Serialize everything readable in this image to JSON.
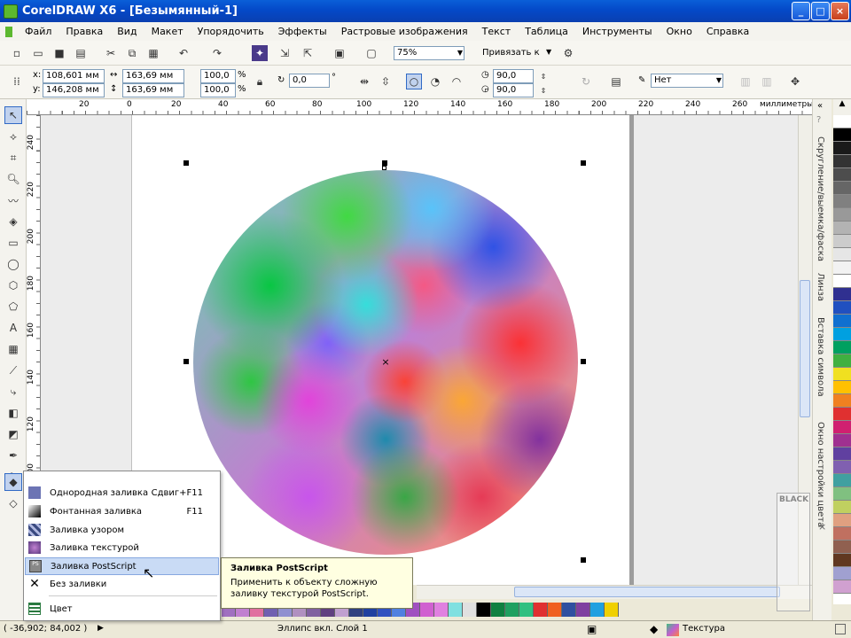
{
  "window": {
    "title": "CorelDRAW X6 - [Безымянный-1]",
    "controls": [
      "_",
      "□",
      "×"
    ]
  },
  "menu": [
    "Файл",
    "Правка",
    "Вид",
    "Макет",
    "Упорядочить",
    "Эффекты",
    "Растровые изображения",
    "Текст",
    "Таблица",
    "Инструменты",
    "Окно",
    "Справка"
  ],
  "toolbar": {
    "zoom": "75%",
    "snap_label": "Привязать к"
  },
  "propbar": {
    "x": "108,601 мм",
    "y": "146,208 мм",
    "w": "163,69 мм",
    "h": "163,69 мм",
    "sx": "100,0",
    "sy": "100,0",
    "pct": "%",
    "rotation": "0,0",
    "deg": "°",
    "angle1": "90,0",
    "angle2": "90,0",
    "outline": "Нет"
  },
  "ruler": {
    "top_ticks": [
      "20",
      "0",
      "20",
      "40",
      "60",
      "80",
      "100",
      "120",
      "140",
      "160",
      "180",
      "200",
      "220",
      "240",
      "260"
    ],
    "units": "миллиметры",
    "left_ticks": [
      "240",
      "220",
      "200",
      "180",
      "160",
      "140",
      "120",
      "100"
    ]
  },
  "dockers": [
    "Скругление/выемка/фаска",
    "Линза",
    "Вставка символа",
    "Окно настройки цвета"
  ],
  "fill_menu": {
    "items": [
      {
        "label": "Однородная заливка",
        "shortcut": "Сдвиг+F11",
        "icon": "uniform-fill-icon",
        "color": "#6c74b4"
      },
      {
        "label": "Фонтанная заливка",
        "shortcut": "F11",
        "icon": "fountain-fill-icon",
        "color": "#333333"
      },
      {
        "label": "Заливка узором",
        "shortcut": "",
        "icon": "pattern-fill-icon",
        "color": "#5a6aa0"
      },
      {
        "label": "Заливка текстурой",
        "shortcut": "",
        "icon": "texture-fill-icon",
        "color": "#7a5aa0"
      },
      {
        "label": "Заливка PostScript",
        "shortcut": "",
        "icon": "postscript-fill-icon",
        "color": "#888888"
      },
      {
        "label": "Без заливки",
        "shortcut": "",
        "icon": "no-fill-icon",
        "color": "#333333"
      },
      {
        "label": "Цвет",
        "shortcut": "",
        "icon": "color-icon",
        "color": "#2a7a40"
      }
    ]
  },
  "tooltip": {
    "title": "Заливка PostScript",
    "body": "Применить к объекту сложную заливку текстурой PostScript."
  },
  "status": {
    "coords": "( -36,902; 84,002 )",
    "object": "Эллипс вкл. Слой 1",
    "fill": "Текстура"
  },
  "watermark": {
    "text": "BLACK"
  },
  "palette_colors": [
    "#ffffff",
    "#000000",
    "#1a1a1a",
    "#333333",
    "#4d4d4d",
    "#666666",
    "#808080",
    "#999999",
    "#b3b3b3",
    "#cccccc",
    "#e6e6e6",
    "#f2f2f2",
    "#ffffff",
    "#303090",
    "#2050c0",
    "#1070d0",
    "#00a0e0",
    "#00a060",
    "#40b040",
    "#f0e020",
    "#ffc000",
    "#f08020",
    "#e03030",
    "#d02070",
    "#a03090",
    "#6040a0",
    "#8060b0",
    "#40a0a0",
    "#80c080",
    "#c0d060",
    "#e0a080",
    "#c07060",
    "#906050",
    "#603820",
    "#a0a0d0",
    "#d0a0d0",
    "#ff8080",
    "#80ff80"
  ],
  "hpalette_colors": [
    "#a070c0",
    "#c080d0",
    "#e070a0",
    "#7060b0",
    "#9090d0",
    "#b090c0",
    "#8060a0",
    "#604080",
    "#c0a0d0",
    "#304080",
    "#2040a0",
    "#3050c0",
    "#5080e0",
    "#a050c0",
    "#d060d0",
    "#e080e0",
    "#80e0e0",
    "#e0e0e0",
    "#000000",
    "#108040",
    "#20a060",
    "#30c080",
    "#e03030",
    "#f06020",
    "#3050a0",
    "#8040a0",
    "#20a0e0",
    "#f0d000"
  ]
}
